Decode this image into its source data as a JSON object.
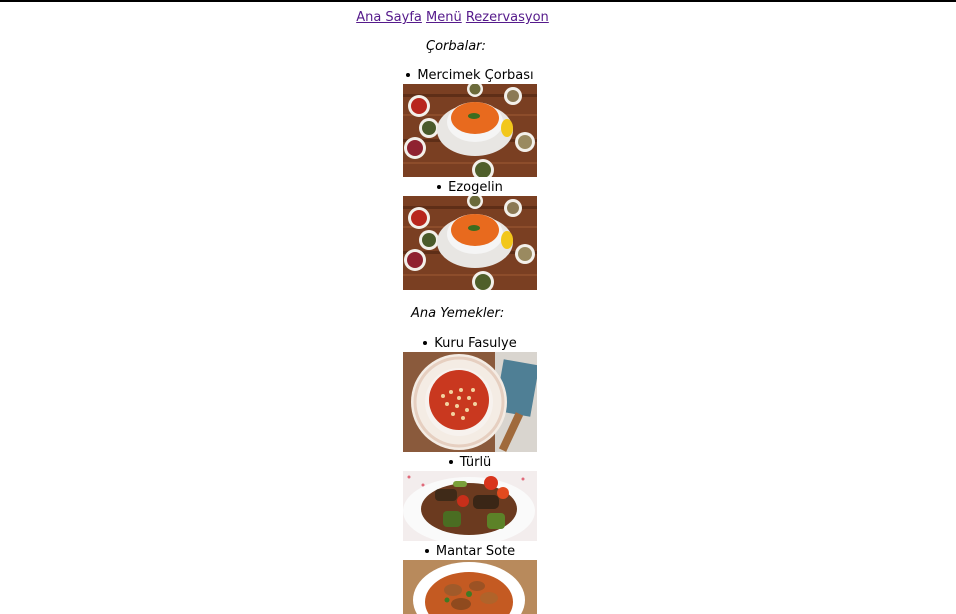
{
  "nav": {
    "home": "Ana Sayfa",
    "menu": "Menü",
    "reservation": "Rezervasyon"
  },
  "categories": {
    "soups": {
      "title": "Çorbalar:",
      "items": [
        {
          "name": "Mercimek Çorbası",
          "image": "lentil-soup-photo"
        },
        {
          "name": "Ezogelin",
          "image": "lentil-soup-photo"
        }
      ]
    },
    "mains": {
      "title": "Ana Yemekler:",
      "items": [
        {
          "name": "Kuru Fasulye",
          "image": "bean-stew-photo"
        },
        {
          "name": "Türlü",
          "image": "vegetable-stew-photo"
        },
        {
          "name": "Mantar Sote",
          "image": "mushroom-saute-photo"
        }
      ]
    }
  }
}
